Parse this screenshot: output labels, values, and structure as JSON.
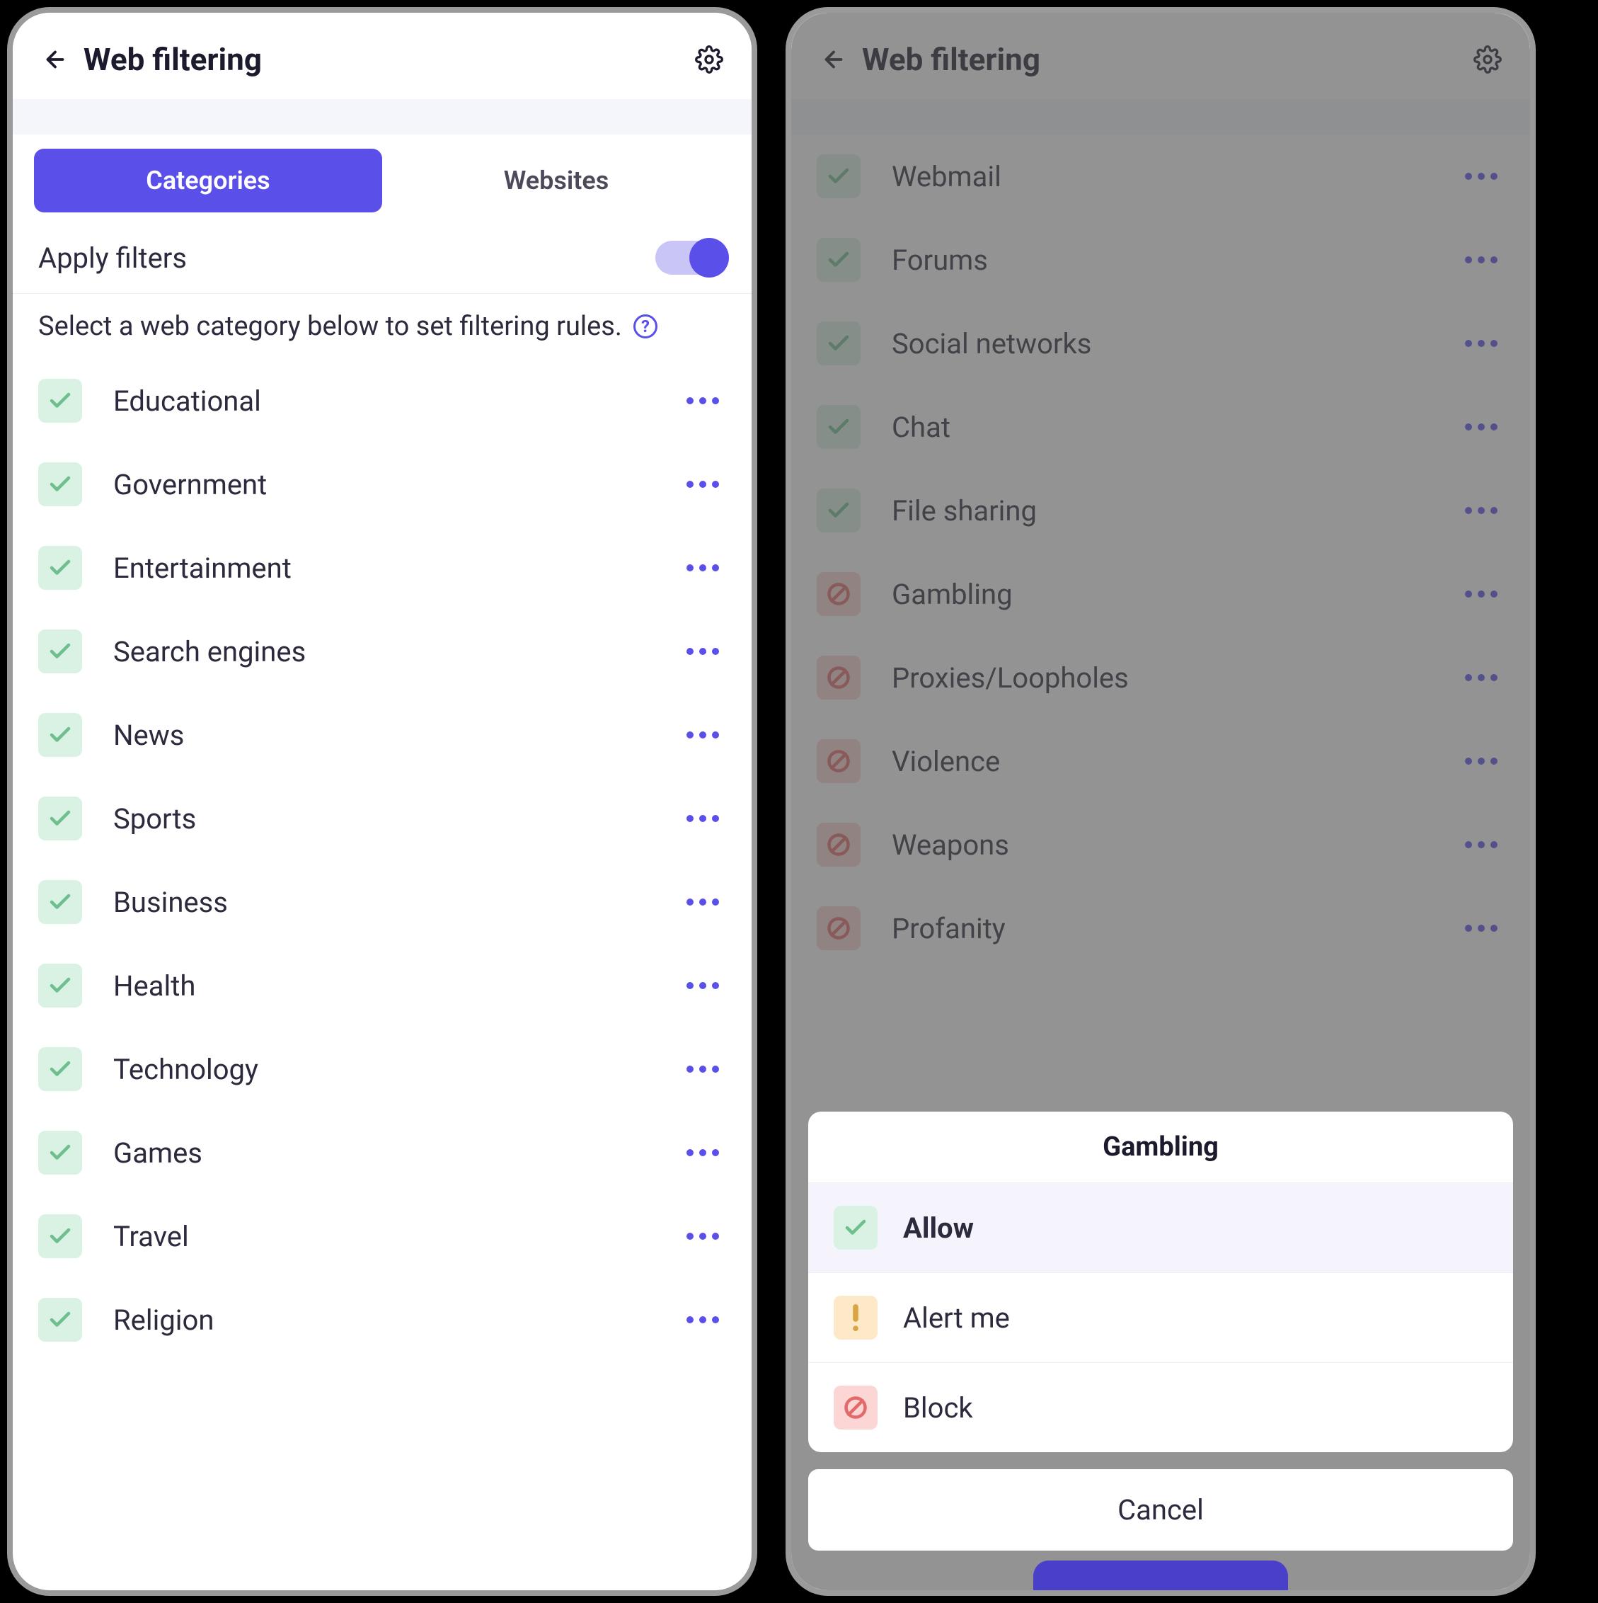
{
  "colors": {
    "accent": "#5b4fe9",
    "allow_bg": "#d9f2e3",
    "allow_fg": "#6fbf8e",
    "block_bg": "#fcd5d5",
    "block_fg": "#e26a6a",
    "alert_bg": "#fde8c8",
    "alert_fg": "#d9a441"
  },
  "left": {
    "header": {
      "title": "Web filtering"
    },
    "tabs": {
      "categories": "Categories",
      "websites": "Websites",
      "active": "categories"
    },
    "apply_filters_label": "Apply filters",
    "apply_filters_on": true,
    "instruction": "Select a web category below to set filtering rules.",
    "categories": [
      {
        "label": "Educational",
        "status": "allow"
      },
      {
        "label": "Government",
        "status": "allow"
      },
      {
        "label": "Entertainment",
        "status": "allow"
      },
      {
        "label": "Search engines",
        "status": "allow"
      },
      {
        "label": "News",
        "status": "allow"
      },
      {
        "label": "Sports",
        "status": "allow"
      },
      {
        "label": "Business",
        "status": "allow"
      },
      {
        "label": "Health",
        "status": "allow"
      },
      {
        "label": "Technology",
        "status": "allow"
      },
      {
        "label": "Games",
        "status": "allow"
      },
      {
        "label": "Travel",
        "status": "allow"
      },
      {
        "label": "Religion",
        "status": "allow"
      }
    ]
  },
  "right": {
    "header": {
      "title": "Web filtering"
    },
    "categories": [
      {
        "label": "Webmail",
        "status": "allow"
      },
      {
        "label": "Forums",
        "status": "allow"
      },
      {
        "label": "Social networks",
        "status": "allow"
      },
      {
        "label": "Chat",
        "status": "allow"
      },
      {
        "label": "File sharing",
        "status": "allow"
      },
      {
        "label": "Gambling",
        "status": "block"
      },
      {
        "label": "Proxies/Loopholes",
        "status": "block"
      },
      {
        "label": "Violence",
        "status": "block"
      },
      {
        "label": "Weapons",
        "status": "block"
      },
      {
        "label": "Profanity",
        "status": "block"
      }
    ],
    "sheet": {
      "title": "Gambling",
      "options": [
        {
          "key": "allow",
          "label": "Allow",
          "selected": true
        },
        {
          "key": "alert",
          "label": "Alert me",
          "selected": false
        },
        {
          "key": "block",
          "label": "Block",
          "selected": false
        }
      ],
      "cancel": "Cancel"
    }
  }
}
